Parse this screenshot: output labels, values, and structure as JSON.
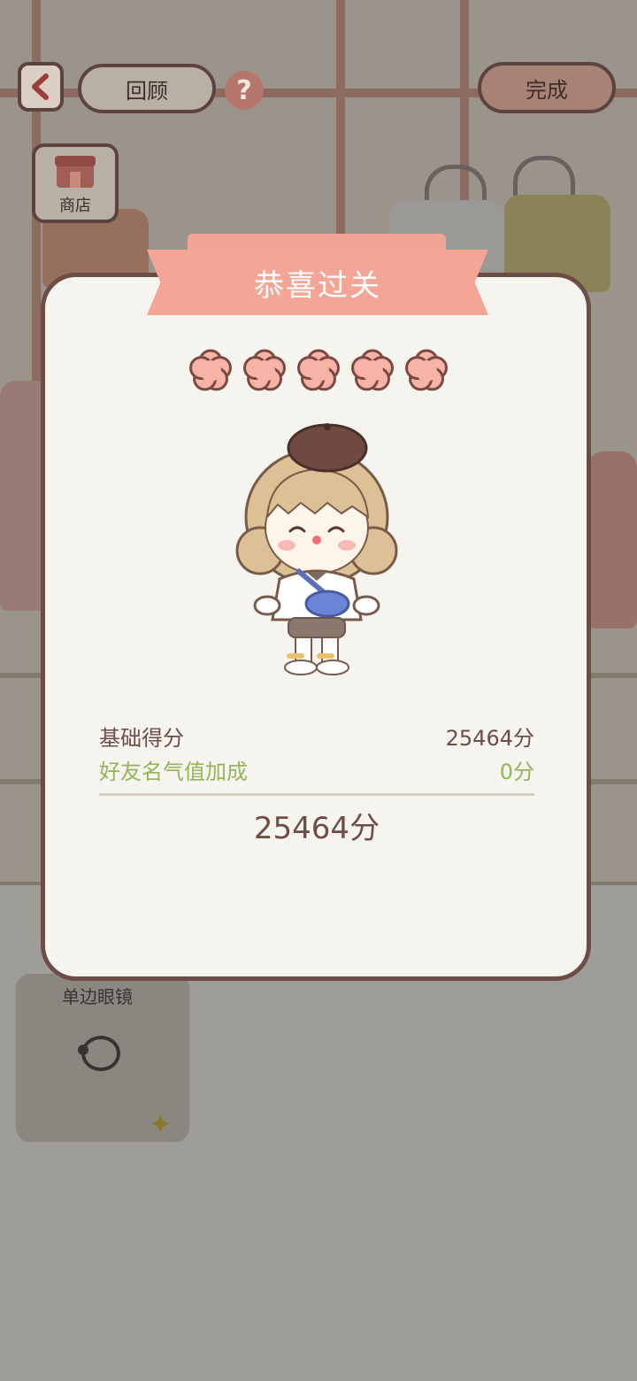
{
  "header": {
    "review_label": "回顾",
    "help_symbol": "?",
    "done_label": "完成",
    "shop_label": "商店"
  },
  "modal": {
    "title": "恭喜过关",
    "stars": 5,
    "base_score_label": "基础得分",
    "base_score_value": "25464分",
    "bonus_label": "好友名气值加成",
    "bonus_value": "0分",
    "total": "25464分"
  },
  "item": {
    "name": "单边眼镜",
    "sparkle": "✦"
  },
  "colors": {
    "accent": "#f4a596",
    "border": "#6e4d47",
    "bonus_text": "#93b55a",
    "modal_bg": "#f6f4ee"
  }
}
